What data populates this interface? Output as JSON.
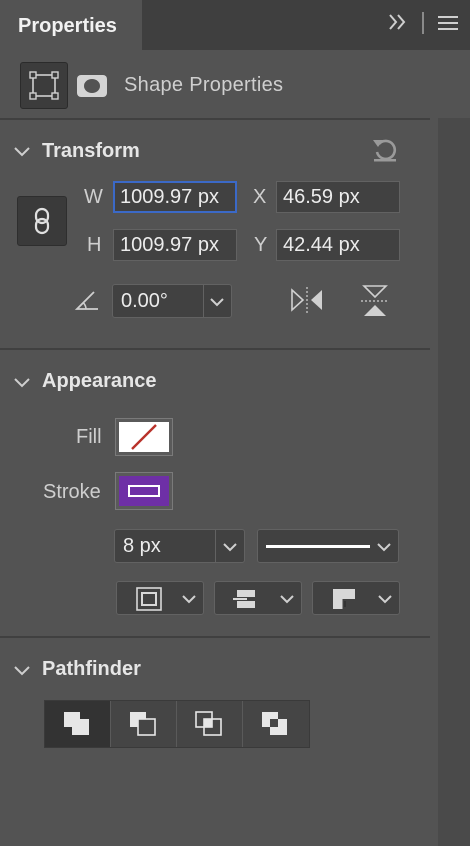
{
  "panel": {
    "tab_label": "Properties"
  },
  "shape": {
    "title": "Shape Properties"
  },
  "transform": {
    "title": "Transform",
    "w_label": "W",
    "w_value": "1009.97 px",
    "h_label": "H",
    "h_value": "1009.97 px",
    "x_label": "X",
    "x_value": "46.59 px",
    "y_label": "Y",
    "y_value": "42.44 px",
    "angle_value": "0.00°"
  },
  "appearance": {
    "title": "Appearance",
    "fill_label": "Fill",
    "stroke_label": "Stroke",
    "stroke_width": "8 px",
    "stroke_color": "#6e2fa6"
  },
  "pathfinder": {
    "title": "Pathfinder",
    "buttons": [
      "unite-shapes",
      "subtract-front-shape",
      "intersect-shapes",
      "exclude-overlapping-shapes"
    ]
  },
  "icons": {
    "expand": "double-chevron-right-icon",
    "menu": "hamburger-menu-icon",
    "reset": "reset-icon",
    "link": "link-icon",
    "angle": "angle-icon",
    "flip_h": "flip-horizontal-icon",
    "flip_v": "flip-vertical-icon"
  },
  "colors": {
    "focus_border": "#3b69c7",
    "no_fill_slash": "#b8322a"
  }
}
